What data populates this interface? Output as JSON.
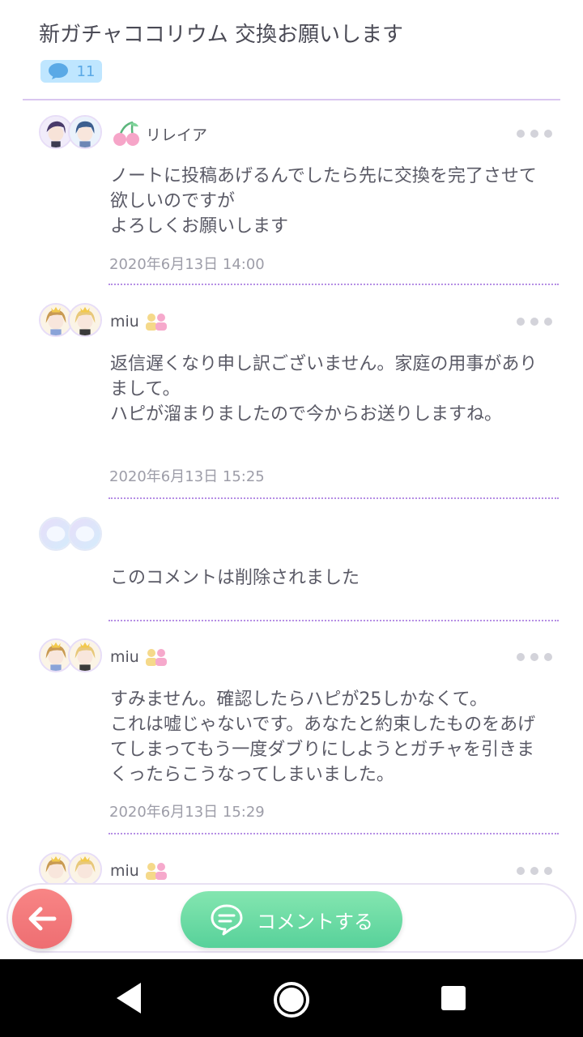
{
  "page": {
    "title": "新ガチャココリウム 交換お願いします",
    "comment_count": "11"
  },
  "colors": {
    "accent_purple": "#b58ee4",
    "badge_blue": "#bfe6ff",
    "comment_button_green": "#57d19a",
    "back_button_red": "#ee6e72"
  },
  "comments": [
    {
      "author": "リレイア",
      "rank_icon": "cherry-icon",
      "text": "ノートに投稿あげるんでしたら先に交換を完了させて欲しいのですが\nよろしくお願いします",
      "date": "2020年6月13日 14:00"
    },
    {
      "author": "miu",
      "friend_icon": "friend-icon",
      "text": "返信遅くなり申し訳ございません。家庭の用事がありまして。\nハピが溜まりましたので今からお送りしますね。",
      "date": "2020年6月13日 15:25"
    },
    {
      "author": "",
      "text": "このコメントは削除されました",
      "date": ""
    },
    {
      "author": "miu",
      "friend_icon": "friend-icon",
      "text": "すみません。確認したらハピが25しかなくて。\nこれは嘘じゃないです。あなたと約束したものをあげてしまってもう一度ダブりにしようとガチャを引きまくったらこうなってしまいました。",
      "date": "2020年6月13日 15:29"
    },
    {
      "author": "miu",
      "friend_icon": "friend-icon"
    }
  ],
  "bottom_bar": {
    "comment_button_label": "コメントする",
    "back_icon": "arrow-left-icon",
    "comment_icon": "speech-bubble-icon"
  },
  "system_nav": {
    "back_icon": "nav-back-triangle-icon",
    "home_icon": "nav-home-circle-icon",
    "recent_icon": "nav-recent-square-icon"
  }
}
